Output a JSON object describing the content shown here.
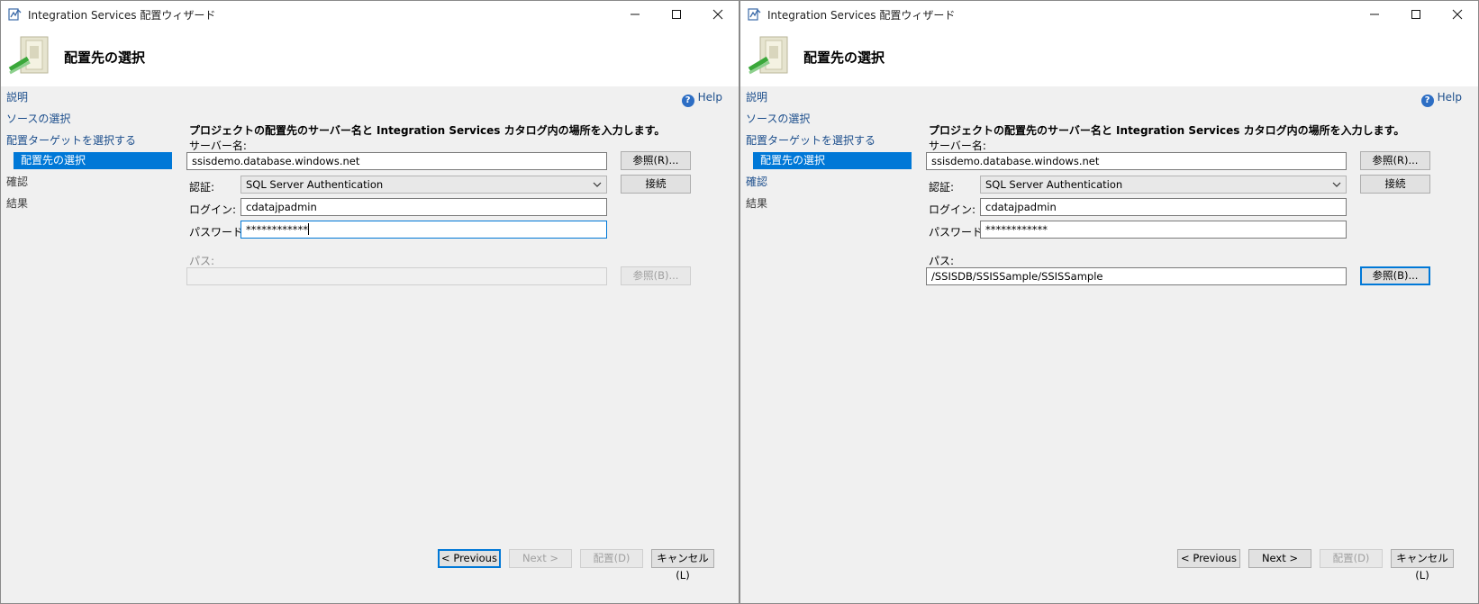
{
  "windows": [
    {
      "title": "Integration Services 配置ウィザード",
      "page_title": "配置先の選択",
      "nav": [
        "説明",
        "ソースの選択",
        "配置ターゲットを選択する",
        "配置先の選択",
        "確認",
        "結果"
      ],
      "help_label": "Help",
      "instruction": "プロジェクトの配置先のサーバー名と Integration Services カタログ内の場所を入力します。",
      "server_label": "サーバー名:",
      "server_value": "ssisdemo.database.windows.net",
      "browse_server_label": "参照(R)...",
      "auth_label": "認証:",
      "auth_value": "SQL Server Authentication",
      "connect_label": "接続",
      "login_label": "ログイン:",
      "login_value": "cdatajpadmin",
      "password_label": "パスワード:",
      "password_value": "************",
      "path_label": "パス:",
      "path_value": "",
      "browse_path_label": "参照(B)...",
      "prev_label": "< Previous",
      "next_label": "Next >",
      "deploy_label": "配置(D)",
      "cancel_label": "キャンセル(L)"
    },
    {
      "title": "Integration Services 配置ウィザード",
      "page_title": "配置先の選択",
      "nav": [
        "説明",
        "ソースの選択",
        "配置ターゲットを選択する",
        "配置先の選択",
        "確認",
        "結果"
      ],
      "help_label": "Help",
      "instruction": "プロジェクトの配置先のサーバー名と Integration Services カタログ内の場所を入力します。",
      "server_label": "サーバー名:",
      "server_value": "ssisdemo.database.windows.net",
      "browse_server_label": "参照(R)...",
      "auth_label": "認証:",
      "auth_value": "SQL Server Authentication",
      "connect_label": "接続",
      "login_label": "ログイン:",
      "login_value": "cdatajpadmin",
      "password_label": "パスワード:",
      "password_value": "************",
      "path_label": "パス:",
      "path_value": "/SSISDB/SSISSample/SSISSample",
      "browse_path_label": "参照(B)...",
      "prev_label": "< Previous",
      "next_label": "Next >",
      "deploy_label": "配置(D)",
      "cancel_label": "キャンセル(L)"
    }
  ],
  "colors": {
    "selection": "#0078d7",
    "link": "#1c4e8c",
    "background": "#f0f0f0"
  }
}
